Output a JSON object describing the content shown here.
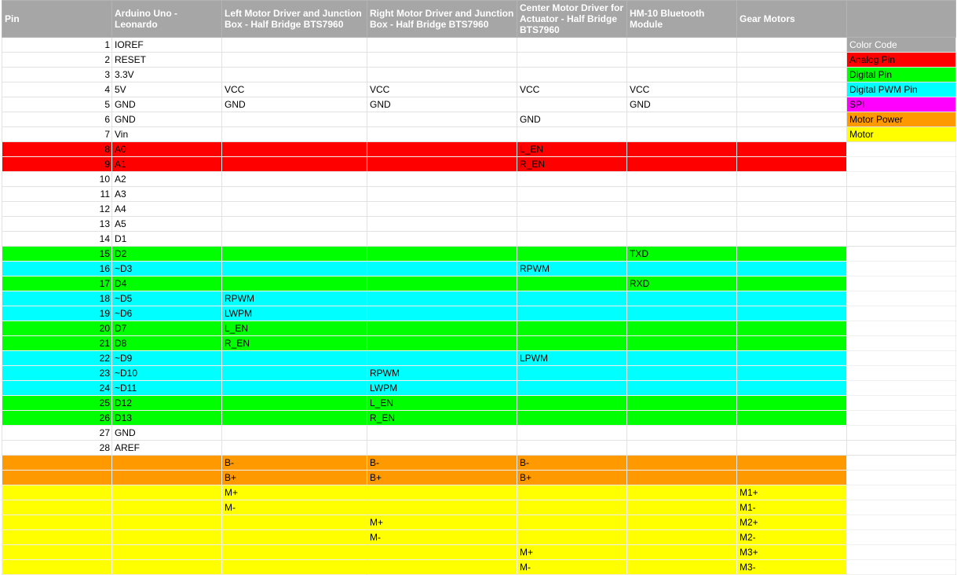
{
  "colors": {
    "header": "#a6a6a6",
    "analog": "#ff0000",
    "digital": "#00ff00",
    "pwm": "#00ffff",
    "spi": "#ff00ff",
    "power": "#ff9900",
    "motor": "#ffff00"
  },
  "headers": [
    "Pin",
    "Arduino Uno - Leonardo",
    "Left Motor Driver and Junction Box - Half Bridge BTS7960",
    "Right Motor Driver and Junction Box - Half Bridge BTS7960",
    "Center Motor Driver for Actuator - Half Bridge BTS7960",
    "HM-10 Bluetooth Module",
    "Gear Motors"
  ],
  "legend": [
    {
      "label": "Color Code",
      "color": "header",
      "text_color": "#ffffff"
    },
    {
      "label": "Analog Pin",
      "color": "analog",
      "text_color": "#000000"
    },
    {
      "label": "Digital Pin",
      "color": "digital",
      "text_color": "#000000"
    },
    {
      "label": "Digital PWM Pin",
      "color": "pwm",
      "text_color": "#000000"
    },
    {
      "label": "SPI",
      "color": "spi",
      "text_color": "#000000"
    },
    {
      "label": "Motor Power",
      "color": "power",
      "text_color": "#000000"
    },
    {
      "label": "Motor",
      "color": "motor",
      "text_color": "#000000"
    }
  ],
  "rows": [
    {
      "color": null,
      "cells": [
        "1",
        "IOREF",
        "",
        "",
        "",
        "",
        ""
      ]
    },
    {
      "color": null,
      "cells": [
        "2",
        "RESET",
        "",
        "",
        "",
        "",
        ""
      ]
    },
    {
      "color": null,
      "cells": [
        "3",
        "3.3V",
        "",
        "",
        "",
        "",
        ""
      ]
    },
    {
      "color": null,
      "cells": [
        "4",
        "5V",
        "VCC",
        "VCC",
        "VCC",
        "VCC",
        ""
      ]
    },
    {
      "color": null,
      "cells": [
        "5",
        "GND",
        "GND",
        "GND",
        "",
        "GND",
        ""
      ]
    },
    {
      "color": null,
      "cells": [
        "6",
        "GND",
        "",
        "",
        "GND",
        "",
        ""
      ]
    },
    {
      "color": null,
      "cells": [
        "7",
        "Vin",
        "",
        "",
        "",
        "",
        ""
      ]
    },
    {
      "color": "analog",
      "cells": [
        "8",
        "A0",
        "",
        "",
        "L_EN",
        "",
        ""
      ]
    },
    {
      "color": "analog",
      "cells": [
        "9",
        "A1",
        "",
        "",
        "R_EN",
        "",
        ""
      ]
    },
    {
      "color": null,
      "cells": [
        "10",
        "A2",
        "",
        "",
        "",
        "",
        ""
      ]
    },
    {
      "color": null,
      "cells": [
        "11",
        "A3",
        "",
        "",
        "",
        "",
        ""
      ]
    },
    {
      "color": null,
      "cells": [
        "12",
        "A4",
        "",
        "",
        "",
        "",
        ""
      ]
    },
    {
      "color": null,
      "cells": [
        "13",
        "A5",
        "",
        "",
        "",
        "",
        ""
      ]
    },
    {
      "color": null,
      "cells": [
        "14",
        "D1",
        "",
        "",
        "",
        "",
        ""
      ]
    },
    {
      "color": "digital",
      "cells": [
        "15",
        "D2",
        "",
        "",
        "",
        "TXD",
        ""
      ]
    },
    {
      "color": "pwm",
      "cells": [
        "16",
        "~D3",
        "",
        "",
        "RPWM",
        "",
        ""
      ]
    },
    {
      "color": "digital",
      "cells": [
        "17",
        "D4",
        "",
        "",
        "",
        "RXD",
        ""
      ]
    },
    {
      "color": "pwm",
      "cells": [
        "18",
        "~D5",
        "RPWM",
        "",
        "",
        "",
        ""
      ]
    },
    {
      "color": "pwm",
      "cells": [
        "19",
        "~D6",
        "LWPM",
        "",
        "",
        "",
        ""
      ]
    },
    {
      "color": "digital",
      "cells": [
        "20",
        "D7",
        "L_EN",
        "",
        "",
        "",
        ""
      ]
    },
    {
      "color": "digital",
      "cells": [
        "21",
        "D8",
        "R_EN",
        "",
        "",
        "",
        ""
      ]
    },
    {
      "color": "pwm",
      "cells": [
        "22",
        "~D9",
        "",
        "",
        "LPWM",
        "",
        ""
      ]
    },
    {
      "color": "pwm",
      "cells": [
        "23",
        "~D10",
        "",
        "RPWM",
        "",
        "",
        ""
      ]
    },
    {
      "color": "pwm",
      "cells": [
        "24",
        "~D11",
        "",
        "LWPM",
        "",
        "",
        ""
      ]
    },
    {
      "color": "digital",
      "cells": [
        "25",
        "D12",
        "",
        "L_EN",
        "",
        "",
        ""
      ]
    },
    {
      "color": "digital",
      "cells": [
        "26",
        "D13",
        "",
        "R_EN",
        "",
        "",
        ""
      ]
    },
    {
      "color": null,
      "cells": [
        "27",
        "GND",
        "",
        "",
        "",
        "",
        ""
      ]
    },
    {
      "color": null,
      "cells": [
        "28",
        "AREF",
        "",
        "",
        "",
        "",
        ""
      ]
    },
    {
      "color": "power",
      "cells": [
        "",
        "",
        "B-",
        "B-",
        "B-",
        "",
        ""
      ]
    },
    {
      "color": "power",
      "cells": [
        "",
        "",
        "B+",
        "B+",
        "B+",
        "",
        ""
      ]
    },
    {
      "color": "motor",
      "cells": [
        "",
        "",
        "M+",
        "",
        "",
        "",
        "M1+"
      ]
    },
    {
      "color": "motor",
      "cells": [
        "",
        "",
        "M-",
        "",
        "",
        "",
        "M1-"
      ]
    },
    {
      "color": "motor",
      "cells": [
        "",
        "",
        "",
        "M+",
        "",
        "",
        "M2+"
      ]
    },
    {
      "color": "motor",
      "cells": [
        "",
        "",
        "",
        "M-",
        "",
        "",
        "M2-"
      ]
    },
    {
      "color": "motor",
      "cells": [
        "",
        "",
        "",
        "",
        "M+",
        "",
        "M3+"
      ]
    },
    {
      "color": "motor",
      "cells": [
        "",
        "",
        "",
        "",
        "M-",
        "",
        "M3-"
      ]
    }
  ]
}
